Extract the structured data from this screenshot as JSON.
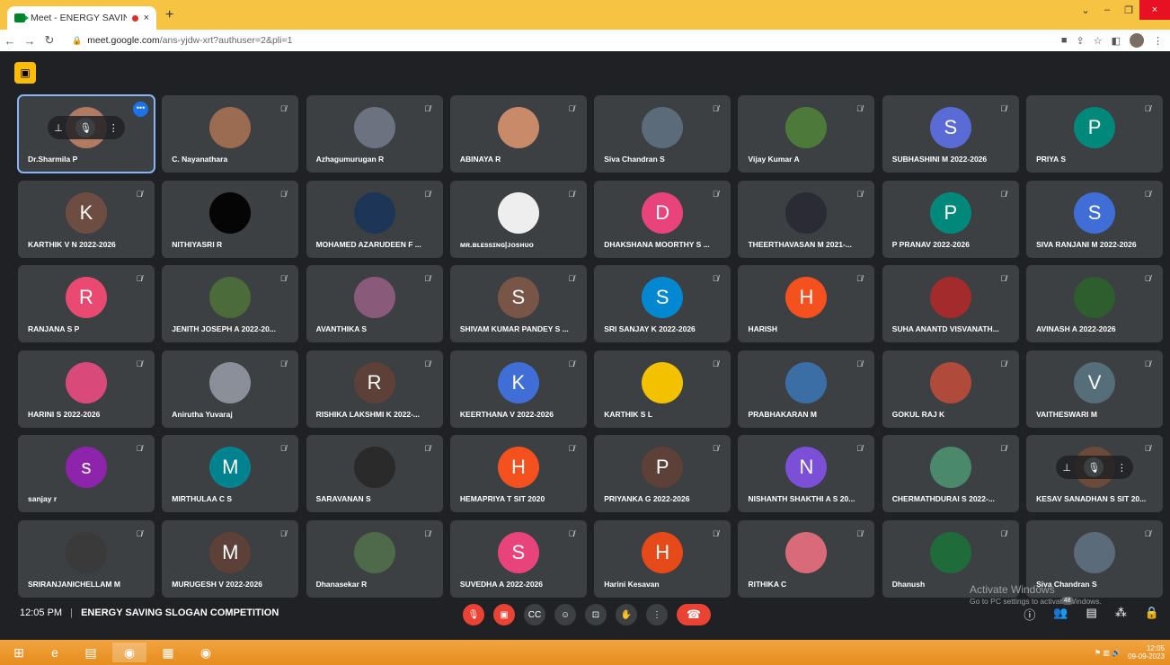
{
  "tab": {
    "title": "Meet - ENERGY SAVING SLO",
    "close": "×",
    "new": "+"
  },
  "window": {
    "min": "–",
    "max": "❐",
    "close": "×"
  },
  "address": {
    "url": "meet.google.com",
    "path": "/ans-yjdw-xrt?authuser=2&pli=1"
  },
  "participants": [
    {
      "name": "Dr.Sharmila P",
      "init": "",
      "color": "#b07a63",
      "photo": true,
      "active": true
    },
    {
      "name": "C. Nayanathara",
      "init": "",
      "color": "#9b6b52",
      "photo": true
    },
    {
      "name": "Azhagumurugan R",
      "init": "",
      "color": "#6b7280",
      "photo": true
    },
    {
      "name": "ABINAYA R",
      "init": "",
      "color": "#c98a6a",
      "photo": true
    },
    {
      "name": "Siva Chandran S",
      "init": "",
      "color": "#5b6b7a",
      "photo": true
    },
    {
      "name": "Vijay Kumar A",
      "init": "",
      "color": "#4d7a3a",
      "photo": true
    },
    {
      "name": "SUBHASHINI M 2022-2026",
      "init": "S",
      "color": "#5b6bd6"
    },
    {
      "name": "PRIYA S",
      "init": "P",
      "color": "#00897b"
    },
    {
      "name": "KARTHIK V N 2022-2026",
      "init": "K",
      "color": "#6d4c41"
    },
    {
      "name": "NITHIYASRI R",
      "init": "",
      "color": "#050505",
      "photo": true
    },
    {
      "name": "MOHAMED AZARUDEEN F ...",
      "init": "",
      "color": "#1d3557",
      "photo": true
    },
    {
      "name": "ᴍʀ.ʙʟᴇssɪɴɢ|ᴊᴏsʜᴜᴏ",
      "init": "",
      "color": "#eeeeee",
      "photo": true
    },
    {
      "name": "DHAKSHANA MOORTHY S ...",
      "init": "D",
      "color": "#e8437a"
    },
    {
      "name": "THEERTHAVASAN M 2021-...",
      "init": "",
      "color": "#2b2b35",
      "photo": true
    },
    {
      "name": "P PRANAV 2022-2026",
      "init": "P",
      "color": "#00897b"
    },
    {
      "name": "SIVA RANJANI M 2022-2026",
      "init": "S",
      "color": "#3f6ed6"
    },
    {
      "name": "RANJANA S P",
      "init": "R",
      "color": "#e84a72"
    },
    {
      "name": "JENITH JOSEPH A 2022-20...",
      "init": "",
      "color": "#4c6b3a",
      "photo": true
    },
    {
      "name": "AVANTHIKA S",
      "init": "",
      "color": "#8a5a7a",
      "photo": true
    },
    {
      "name": "SHIVAM KUMAR PANDEY S ...",
      "init": "S",
      "color": "#795548"
    },
    {
      "name": "SRI SANJAY K 2022-2026",
      "init": "S",
      "color": "#0288d1"
    },
    {
      "name": "HARISH",
      "init": "H",
      "color": "#f4511e"
    },
    {
      "name": "SUHA ANANTD VISVANATH...",
      "init": "",
      "color": "#a32b2b",
      "photo": true
    },
    {
      "name": "AVINASH A 2022-2026",
      "init": "",
      "color": "#2e5d2e",
      "photo": true
    },
    {
      "name": "HARINI S 2022-2026",
      "init": "",
      "color": "#d84a7a",
      "photo": true
    },
    {
      "name": "Anirutha Yuvaraj",
      "init": "",
      "color": "#8a8f99",
      "photo": true
    },
    {
      "name": "RISHIKA LAKSHMI K 2022-...",
      "init": "R",
      "color": "#5d4037"
    },
    {
      "name": "KEERTHANA V 2022-2026",
      "init": "K",
      "color": "#3f6ed6"
    },
    {
      "name": "KARTHIK S L",
      "init": "",
      "color": "#f2c200",
      "photo": true
    },
    {
      "name": "PRABHAKARAN M",
      "init": "",
      "color": "#3b6ea5",
      "photo": true
    },
    {
      "name": "GOKUL RAJ K",
      "init": "",
      "color": "#b04a3a",
      "photo": true
    },
    {
      "name": "VAITHESWARI M",
      "init": "V",
      "color": "#546e7a"
    },
    {
      "name": "sanjay r",
      "init": "s",
      "color": "#8e24aa"
    },
    {
      "name": "MIRTHULAA C S",
      "init": "M",
      "color": "#00838f"
    },
    {
      "name": "SARAVANAN S",
      "init": "",
      "color": "#2a2a2a",
      "photo": true
    },
    {
      "name": "HEMAPRIYA T SIT 2020",
      "init": "H",
      "color": "#f4511e"
    },
    {
      "name": "PRIYANKA G 2022-2026",
      "init": "P",
      "color": "#5d4037"
    },
    {
      "name": "NISHANTH SHAKTHI A S 20...",
      "init": "N",
      "color": "#7b4fd6"
    },
    {
      "name": "CHERMATHDURAI S 2022-...",
      "init": "",
      "color": "#4a8a6a",
      "photo": true
    },
    {
      "name": "KESAV SANADHAN S SIT 20...",
      "init": "",
      "color": "#6b4a3a",
      "photo": true,
      "hover": true
    },
    {
      "name": "SRIRANJANICHELLAM M",
      "init": "",
      "color": "#3a3a3a",
      "photo": true
    },
    {
      "name": "MURUGESH V 2022-2026",
      "init": "M",
      "color": "#5d4037"
    },
    {
      "name": "Dhanasekar R",
      "init": "",
      "color": "#4e6a4a",
      "photo": true
    },
    {
      "name": "SUVEDHA A 2022-2026",
      "init": "S",
      "color": "#e8437a"
    },
    {
      "name": "Harini Kesavan",
      "init": "H",
      "color": "#e64a19"
    },
    {
      "name": "RITHIKA C",
      "init": "",
      "color": "#d86a7a",
      "photo": true
    },
    {
      "name": "Dhanush",
      "init": "",
      "color": "#1f6b3a",
      "photo": true
    },
    {
      "name": "Siva Chandran S",
      "init": "",
      "color": "#5b6b7a",
      "photo": true
    }
  ],
  "meeting": {
    "time": "12:05 PM",
    "sep": "|",
    "title": "ENERGY SAVING SLOGAN COMPETITION",
    "people_count": "48"
  },
  "windows_watermark": {
    "line1": "Activate Windows",
    "line2": "Go to PC settings to activate Windows."
  },
  "clock": {
    "time": "12:05",
    "date": "09-09-2023"
  }
}
